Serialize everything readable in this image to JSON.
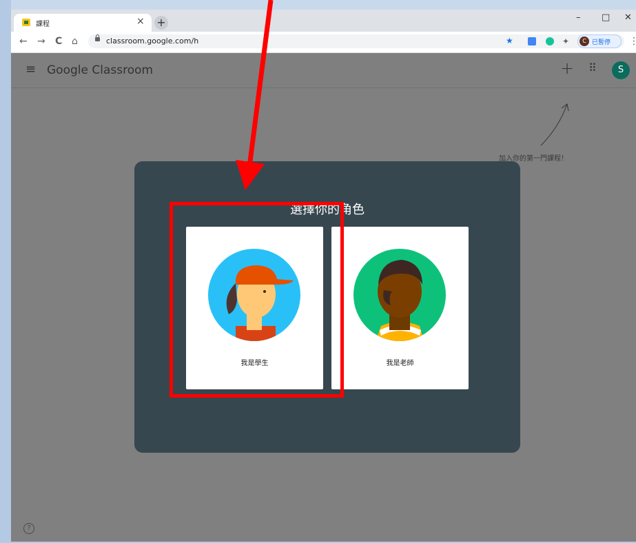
{
  "browser": {
    "tab_title": "課程",
    "tab_close": "×",
    "new_tab": "+",
    "win_min": "–",
    "win_max": "□",
    "win_close": "✕",
    "back": "←",
    "forward": "→",
    "reload": "C",
    "home": "⌂",
    "url": "classroom.google.com/h",
    "profile_initial": "C",
    "profile_status": "已暫停",
    "menu": "⋮"
  },
  "app": {
    "logo_google": "Google",
    "logo_product": "Classroom",
    "menu_icon": "≡",
    "add_icon": "+",
    "apps_icon": "⠿",
    "avatar_initial": "S",
    "hint": "加入你的第一門課程！",
    "help": "?"
  },
  "dialog": {
    "title": "選擇你的角色",
    "student_label": "我是學生",
    "teacher_label": "我是老師"
  },
  "colors": {
    "dialog_bg": "#37474f",
    "highlight": "#ff0000",
    "avatar_bg": "#0b6b5c"
  }
}
